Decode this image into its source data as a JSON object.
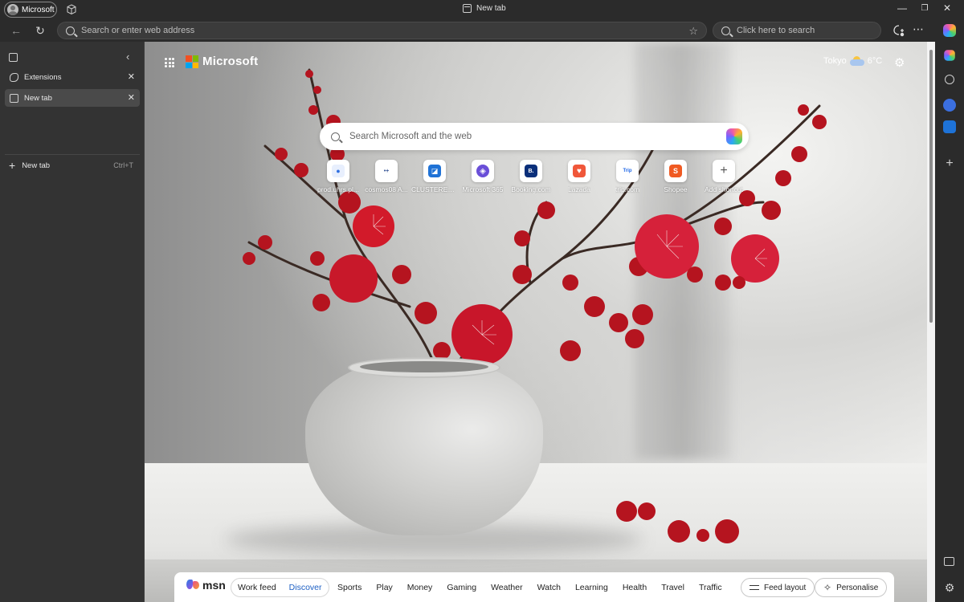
{
  "titlebar": {
    "profile_label": "Microsoft",
    "title": "New tab",
    "controls": [
      "minimize",
      "restore",
      "close"
    ]
  },
  "toolbar": {
    "address_placeholder": "Search or enter web address",
    "search_placeholder": "Click here to search"
  },
  "vertical_tabs": {
    "tabs": [
      {
        "label": "Extensions",
        "icon": "puzzle-icon",
        "active": false
      },
      {
        "label": "New tab",
        "icon": "tab-icon",
        "active": true
      }
    ],
    "new_tab_label": "New tab",
    "new_tab_shortcut": "Ctrl+T"
  },
  "ntp": {
    "brand": "Microsoft",
    "brand_colors": [
      "#f25022",
      "#7fba00",
      "#00a4ef",
      "#ffb900"
    ],
    "weather_city": "Tokyo",
    "weather_temp": "6°C",
    "search_placeholder": "Search Microsoft and the web",
    "shortcuts": [
      {
        "label": "prod.uhrs.pl...",
        "icon_color": "#2f6fe0",
        "glyph": "●"
      },
      {
        "label": "cosmos08 A...",
        "icon_color": "#3d5a99",
        "glyph": "•+"
      },
      {
        "label": "CLUSTERED ...",
        "icon_color": "#1f72d6",
        "glyph": "◪"
      },
      {
        "label": "Microsoft 365",
        "icon_color": "#6a4fd8",
        "glyph": "◈"
      },
      {
        "label": "Booking.com",
        "icon_color": "#0a2f7a",
        "glyph": "B."
      },
      {
        "label": "Lazada",
        "icon_color": "#f0573a",
        "glyph": "♥"
      },
      {
        "label": "trip.com",
        "icon_color": "#1e66e6",
        "glyph": "Trip"
      },
      {
        "label": "Shopee",
        "icon_color": "#f05a22",
        "glyph": "S"
      },
      {
        "label": "Add shortcut",
        "icon_color": "#ffffff",
        "glyph": "+"
      }
    ]
  },
  "msn": {
    "logo_text": "msn",
    "feed_tabs": [
      "Work feed",
      "Discover"
    ],
    "selected_feed": "Discover",
    "accent": "#1e60c4",
    "nav": [
      "Sports",
      "Play",
      "Money",
      "Gaming",
      "Weather",
      "Watch",
      "Learning",
      "Health",
      "Travel",
      "Traffic"
    ],
    "feed_layout_label": "Feed layout",
    "personalise_label": "Personalise"
  }
}
